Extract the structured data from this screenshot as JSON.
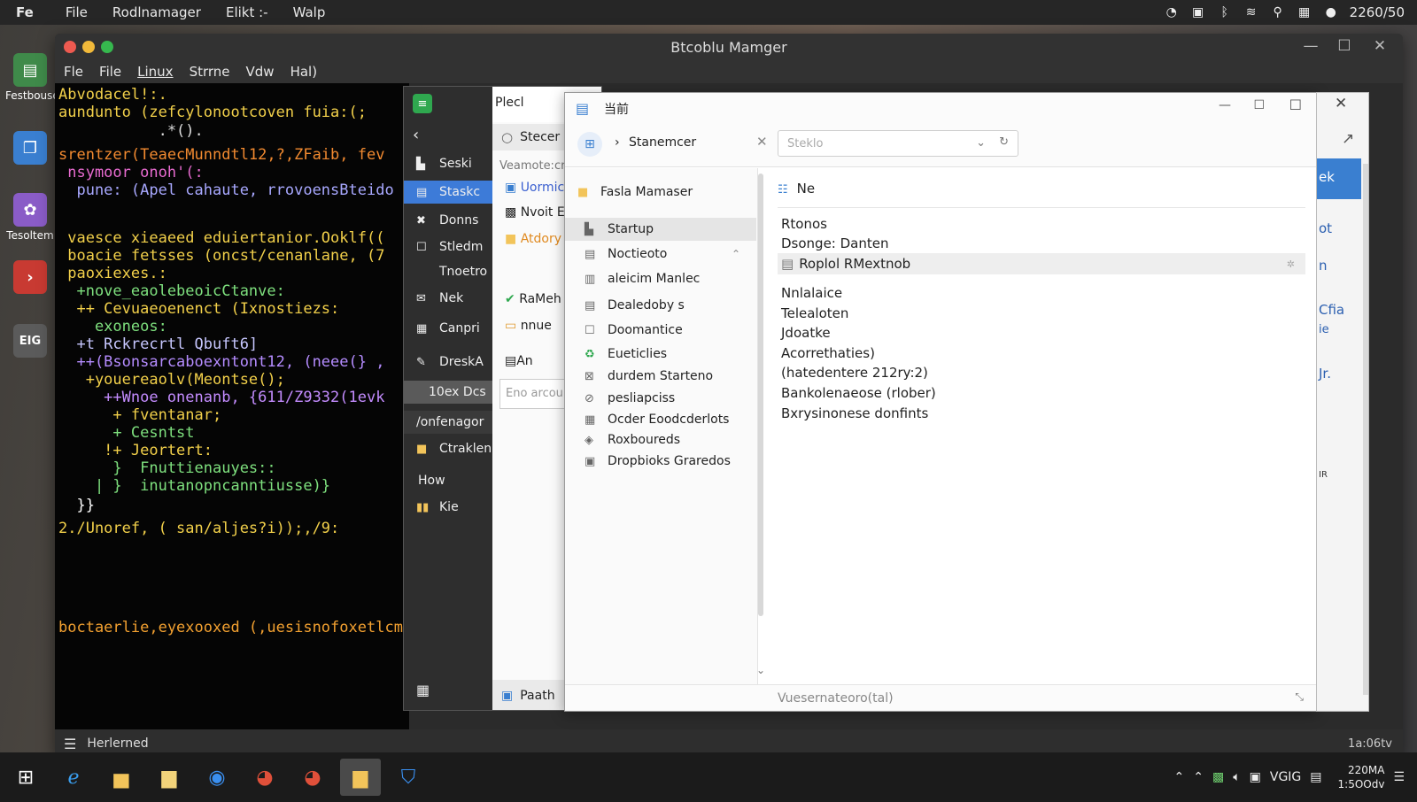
{
  "topbar": {
    "menu": [
      "Fe",
      "File",
      "Rodlnamager",
      "Elikt :-",
      "Walp"
    ],
    "tray_icons": [
      "clock-icon",
      "window-icon",
      "bluetooth-icon",
      "wifi-icon",
      "location-icon",
      "grid-icon",
      "user-icon"
    ],
    "clock": "2260/50"
  },
  "desktop_icons": [
    {
      "label": "Festbouse",
      "icon": "package-icon",
      "color": "#3f8a4a"
    },
    {
      "label": "",
      "icon": "blue-app-icon",
      "color": "#3a7fd0"
    },
    {
      "label": "Tesoltem",
      "icon": "palette-icon",
      "color": "#8a5cc7"
    },
    {
      "label": "",
      "icon": "red-app-icon",
      "color": "#c83a32"
    },
    {
      "label": "",
      "icon": "file-icon",
      "color": "#5b5b5b",
      "text": "EIG"
    }
  ],
  "main_window": {
    "title": "Btcoblu Mamger",
    "menu": [
      "Fle",
      "File",
      "Linux",
      "Strrne",
      "Vdw",
      "Hal)"
    ],
    "terminal_lines": [
      {
        "text": "Abvodacel!:.",
        "color": "#f2d04a"
      },
      {
        "text": "aundunto (zefcylonootcoven fuia:(;",
        "color": "#f2d04a"
      },
      {
        "text": "           .*().",
        "color": "#dddddd"
      },
      {
        "text": "srentzer(TeaecMunndtl12,?,ZFaib, fev",
        "color": "#f28a30"
      },
      {
        "text": " nsymoor onoh'(:",
        "color": "#e86bd0"
      },
      {
        "text": "  pune: (Apel cahaute, rrovoensBteido",
        "color": "#a8a8ff"
      },
      {
        "text": " vaesce xieaeed eduiertanior.Ooklf((",
        "color": "#f2d04a"
      },
      {
        "text": " boacie fetsses (oncst/cenanlane, (7",
        "color": "#f2d04a"
      },
      {
        "text": " paoxiexes.:",
        "color": "#f2d04a"
      },
      {
        "text": "  +nove_eaolebeoicCtanve:",
        "color": "#7ee07e"
      },
      {
        "text": "  ++ Cevuaeoenenct (Ixnostiezs:",
        "color": "#f2d04a"
      },
      {
        "text": "    exoneos:",
        "color": "#7ee07e"
      },
      {
        "text": "  +t Rckrecrtl Qbuft6]",
        "color": "#c7c7ff"
      },
      {
        "text": "  ++(Bsonsarcaboexntont12, (neee(} ,",
        "color": "#b58cff"
      },
      {
        "text": "   +youereaolv(Meontse();",
        "color": "#f2d04a"
      },
      {
        "text": "     ++Wnoe onenanb, {611/Z9332(1evk",
        "color": "#c48cff"
      },
      {
        "text": "      + fventanar;",
        "color": "#f2d04a"
      },
      {
        "text": "      + Cesntst",
        "color": "#7ee07e"
      },
      {
        "text": "     !+ Jeortert:",
        "color": "#f2d04a"
      },
      {
        "text": "      }  Fnuttienauyes::",
        "color": "#7ee07e"
      },
      {
        "text": "    | }  inutanopncanntiusse)}",
        "color": "#7ee07e"
      },
      {
        "text": "  }}",
        "color": "#ffffff"
      },
      {
        "text": "2./Unoref, ( san/aljes?i));,/9:",
        "color": "#f2d04a"
      },
      {
        "text": "boctaerlie,eyexooxed (,uesisnofoxetlcmbsugerc",
        "color": "#f2a030"
      }
    ],
    "statusbar_label": "Herlerned",
    "statusbar_right": "1a:06tv"
  },
  "fm_back": {
    "header": "Plecl",
    "address_label": "Stecer",
    "side_items": [
      "Seski",
      "Staskc",
      "Donns",
      "Stledm",
      "Tnoetro",
      "Nek",
      "Canpri",
      "DreskA",
      "10ex Dcs",
      "/onfenagor",
      "Ctraklen",
      "How",
      "Kie"
    ],
    "mid_header": "Veamote:cr",
    "mid_items": [
      "Uormic",
      "Nvoit E",
      "Atdory",
      "RaMeh",
      "nnue",
      "An"
    ],
    "search_placeholder": "Eno arcou",
    "bottom_label": "Paath"
  },
  "fm_front": {
    "title": "当前",
    "breadcrumb": "Stanemcer",
    "search_placeholder": "Steklo",
    "nav_header": "Fasla Mamaser",
    "nav_items": [
      "Startup",
      "Noctieoto",
      "aleicim Manlec",
      "Dealedoby s",
      "Doomantice",
      "Eueticlies",
      "durdem Starteno",
      "pesliapciss",
      "Ocder Eoodcderlots",
      "Roxboureds",
      "Dropbioks Graredos"
    ],
    "content_header": "Ne",
    "content_rows": [
      "Rtonos",
      "Dsonge: Danten",
      "Roplol RMextnob",
      "Nnlalaice",
      "Telealoten",
      "Jdoatke",
      "Acorrethaties)",
      "(hatedentere 212ry:2)",
      " Bankolenaeose (rlober)",
      " Bxrysinonese donfints"
    ],
    "selected_row": "Roplol RMextnob",
    "bottom_label": "Vuesernateoro(tal)"
  },
  "right_strip": {
    "tab_label": "ek",
    "labels": [
      "ot",
      "n",
      "Cfia",
      "ie",
      "Jr.",
      "IR"
    ]
  },
  "taskbar": {
    "apps": [
      "start-icon",
      "edge-icon",
      "file-explorer-icon",
      "folder-icon",
      "earth-icon",
      "chrome-icon",
      "chrome-icon",
      "file-manager-icon",
      "shield-icon"
    ],
    "tray_text": "VGIG",
    "clock_time": "220MA",
    "clock_date": "1:5OOdv"
  }
}
